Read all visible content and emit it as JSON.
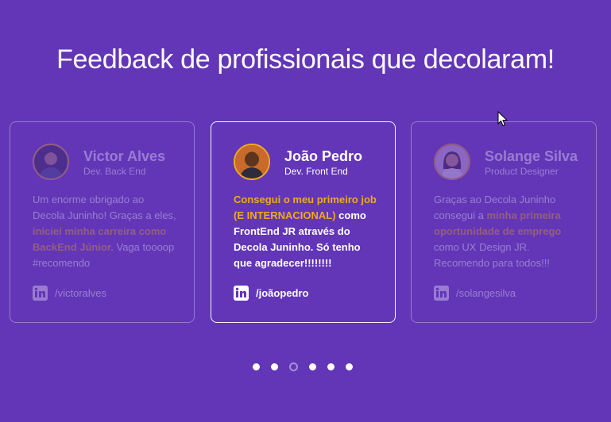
{
  "heading": "Feedback de profissionais que decolaram!",
  "colors": {
    "background": "#6236b7",
    "accent": "#f0a91b",
    "text": "#ffffff"
  },
  "testimonials": [
    {
      "name": "Victor Alves",
      "role": "Dev. Back End",
      "quote_before": "Um enorme obrigado ao Decola Juninho! Graças a eles, ",
      "quote_highlight": "iniciei minha carreira como BackEnd Júnior.",
      "quote_after": " Vaga toooop #recomendo",
      "social_icon": "linkedin-icon",
      "handle": "/victoralves"
    },
    {
      "name": "João Pedro",
      "role": "Dev. Front End",
      "quote_before": "",
      "quote_highlight": "Consegui o meu primeiro job (E INTERNACIONAL)",
      "quote_after": " como FrontEnd JR através do Decola Juninho. Só tenho que agradecer!!!!!!!!",
      "social_icon": "linkedin-icon",
      "handle": "/joãopedro"
    },
    {
      "name": "Solange Silva",
      "role": "Product Designer",
      "quote_before": "Graças ao Decola Juninho consegui a ",
      "quote_highlight": "minha primeira oportunidade de emprego",
      "quote_after": " como UX Design JR. Recomendo para todos!!!",
      "social_icon": "linkedin-icon",
      "handle": "/solangesilva"
    }
  ],
  "carousel": {
    "total_dots": 6,
    "active_index": 2
  }
}
